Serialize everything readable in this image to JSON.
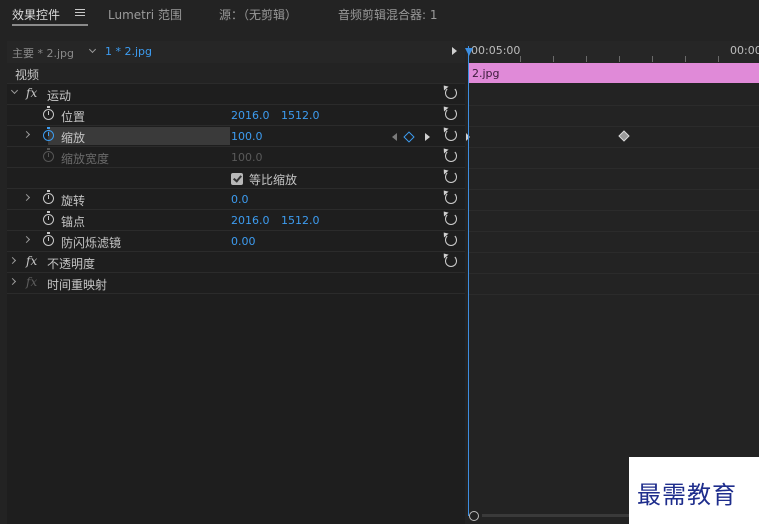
{
  "tabs": {
    "effect_controls": "效果控件",
    "lumetri": "Lumetri 范围",
    "source": "源：（无剪辑）",
    "audio_mixer": "音频剪辑混合器: 1"
  },
  "clip_header": {
    "master": "主要 * 2.jpg",
    "sequence": "1 * 2.jpg"
  },
  "timeline": {
    "tc_start": "00:05:00",
    "tc_end": "00:00",
    "clip_name": "2.jpg"
  },
  "section_video": "视频",
  "effects": {
    "motion": {
      "label": "运动",
      "position": {
        "label": "位置",
        "x": "2016.0",
        "y": "1512.0"
      },
      "scale": {
        "label": "缩放",
        "value": "100.0"
      },
      "scale_width": {
        "label": "缩放宽度",
        "value": "100.0"
      },
      "uniform_scale": {
        "label": "等比缩放",
        "checked": true
      },
      "rotation": {
        "label": "旋转",
        "value": "0.0"
      },
      "anchor": {
        "label": "锚点",
        "x": "2016.0",
        "y": "1512.0"
      },
      "anti_flicker": {
        "label": "防闪烁滤镜",
        "value": "0.00"
      }
    },
    "opacity": {
      "label": "不透明度"
    },
    "time_remap": {
      "label": "时间重映射"
    }
  },
  "icons": {
    "stopwatch": "stopwatch-icon",
    "reset": "reset-icon",
    "fx": "fx-icon",
    "hamburger": "menu-icon"
  },
  "colors": {
    "accent_blue": "#3d9cf0",
    "clip_pink": "#e08ad8",
    "panel_bg": "#1e1e1e"
  },
  "watermark": "最需教育"
}
